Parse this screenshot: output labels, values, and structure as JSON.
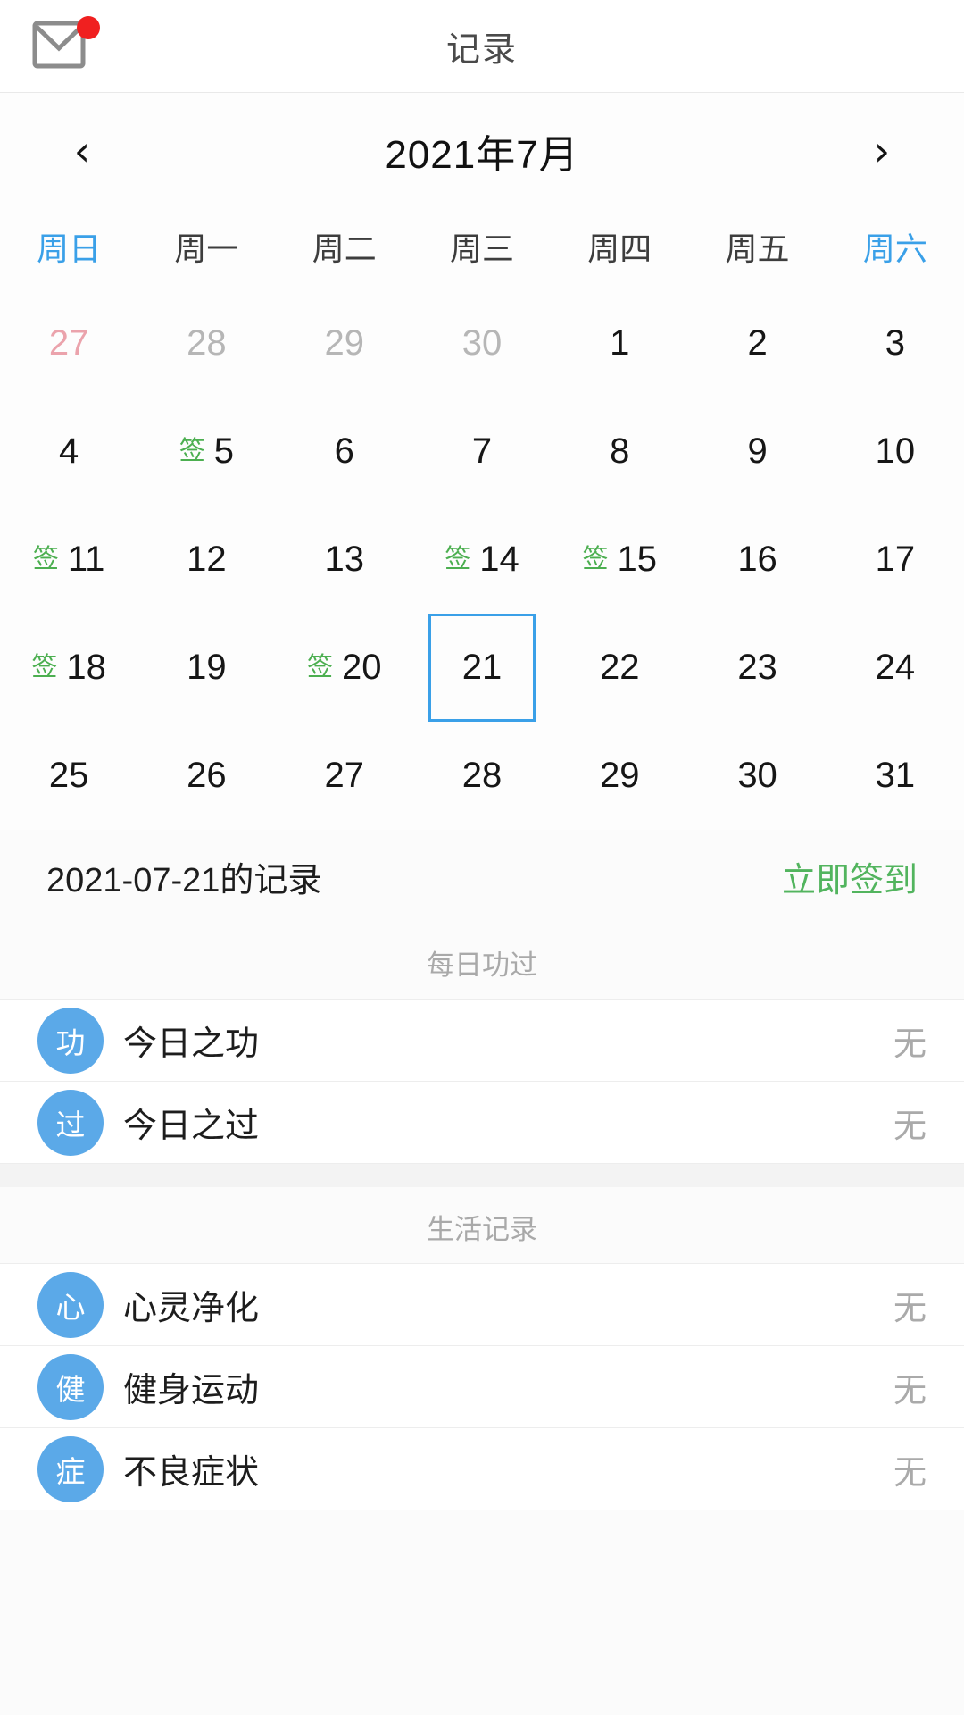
{
  "header": {
    "title": "记录",
    "mail_icon": "mail-icon",
    "badge": true
  },
  "calendar": {
    "prev_icon": "chevron-left-icon",
    "next_icon": "chevron-right-icon",
    "month_label": "2021年7月",
    "weekdays": [
      {
        "label": "周日",
        "weekend": true
      },
      {
        "label": "周一",
        "weekend": false
      },
      {
        "label": "周二",
        "weekend": false
      },
      {
        "label": "周三",
        "weekend": false
      },
      {
        "label": "周四",
        "weekend": false
      },
      {
        "label": "周五",
        "weekend": false
      },
      {
        "label": "周六",
        "weekend": true
      }
    ],
    "sign_mark": "签",
    "days": [
      {
        "n": "27",
        "style": "prevred",
        "sign": false,
        "selected": false
      },
      {
        "n": "28",
        "style": "muted",
        "sign": false,
        "selected": false
      },
      {
        "n": "29",
        "style": "muted",
        "sign": false,
        "selected": false
      },
      {
        "n": "30",
        "style": "muted",
        "sign": false,
        "selected": false
      },
      {
        "n": "1",
        "style": "",
        "sign": false,
        "selected": false
      },
      {
        "n": "2",
        "style": "",
        "sign": false,
        "selected": false
      },
      {
        "n": "3",
        "style": "",
        "sign": false,
        "selected": false
      },
      {
        "n": "4",
        "style": "",
        "sign": false,
        "selected": false
      },
      {
        "n": "5",
        "style": "",
        "sign": true,
        "selected": false
      },
      {
        "n": "6",
        "style": "",
        "sign": false,
        "selected": false
      },
      {
        "n": "7",
        "style": "",
        "sign": false,
        "selected": false
      },
      {
        "n": "8",
        "style": "",
        "sign": false,
        "selected": false
      },
      {
        "n": "9",
        "style": "",
        "sign": false,
        "selected": false
      },
      {
        "n": "10",
        "style": "",
        "sign": false,
        "selected": false
      },
      {
        "n": "11",
        "style": "",
        "sign": true,
        "selected": false
      },
      {
        "n": "12",
        "style": "",
        "sign": false,
        "selected": false
      },
      {
        "n": "13",
        "style": "",
        "sign": false,
        "selected": false
      },
      {
        "n": "14",
        "style": "",
        "sign": true,
        "selected": false
      },
      {
        "n": "15",
        "style": "",
        "sign": true,
        "selected": false
      },
      {
        "n": "16",
        "style": "",
        "sign": false,
        "selected": false
      },
      {
        "n": "17",
        "style": "",
        "sign": false,
        "selected": false
      },
      {
        "n": "18",
        "style": "",
        "sign": true,
        "selected": false
      },
      {
        "n": "19",
        "style": "",
        "sign": false,
        "selected": false
      },
      {
        "n": "20",
        "style": "",
        "sign": true,
        "selected": false
      },
      {
        "n": "21",
        "style": "",
        "sign": false,
        "selected": true
      },
      {
        "n": "22",
        "style": "",
        "sign": false,
        "selected": false
      },
      {
        "n": "23",
        "style": "",
        "sign": false,
        "selected": false
      },
      {
        "n": "24",
        "style": "",
        "sign": false,
        "selected": false
      },
      {
        "n": "25",
        "style": "",
        "sign": false,
        "selected": false
      },
      {
        "n": "26",
        "style": "",
        "sign": false,
        "selected": false
      },
      {
        "n": "27",
        "style": "",
        "sign": false,
        "selected": false
      },
      {
        "n": "28",
        "style": "",
        "sign": false,
        "selected": false
      },
      {
        "n": "29",
        "style": "",
        "sign": false,
        "selected": false
      },
      {
        "n": "30",
        "style": "",
        "sign": false,
        "selected": false
      },
      {
        "n": "31",
        "style": "",
        "sign": false,
        "selected": false
      }
    ]
  },
  "record": {
    "date_label": "2021-07-21的记录",
    "sign_in_label": "立即签到"
  },
  "sections": [
    {
      "title": "每日功过",
      "rows": [
        {
          "avatar": "功",
          "label": "今日之功",
          "value": "无"
        },
        {
          "avatar": "过",
          "label": "今日之过",
          "value": "无"
        }
      ]
    },
    {
      "title": "生活记录",
      "rows": [
        {
          "avatar": "心",
          "label": "心灵净化",
          "value": "无"
        },
        {
          "avatar": "健",
          "label": "健身运动",
          "value": "无"
        },
        {
          "avatar": "症",
          "label": "不良症状",
          "value": "无"
        }
      ]
    }
  ],
  "colors": {
    "accent_blue": "#3aa0e8",
    "avatar_blue": "#5ba9e8",
    "sign_green": "#4caf50",
    "action_green": "#52b45e",
    "badge_red": "#f02020"
  }
}
